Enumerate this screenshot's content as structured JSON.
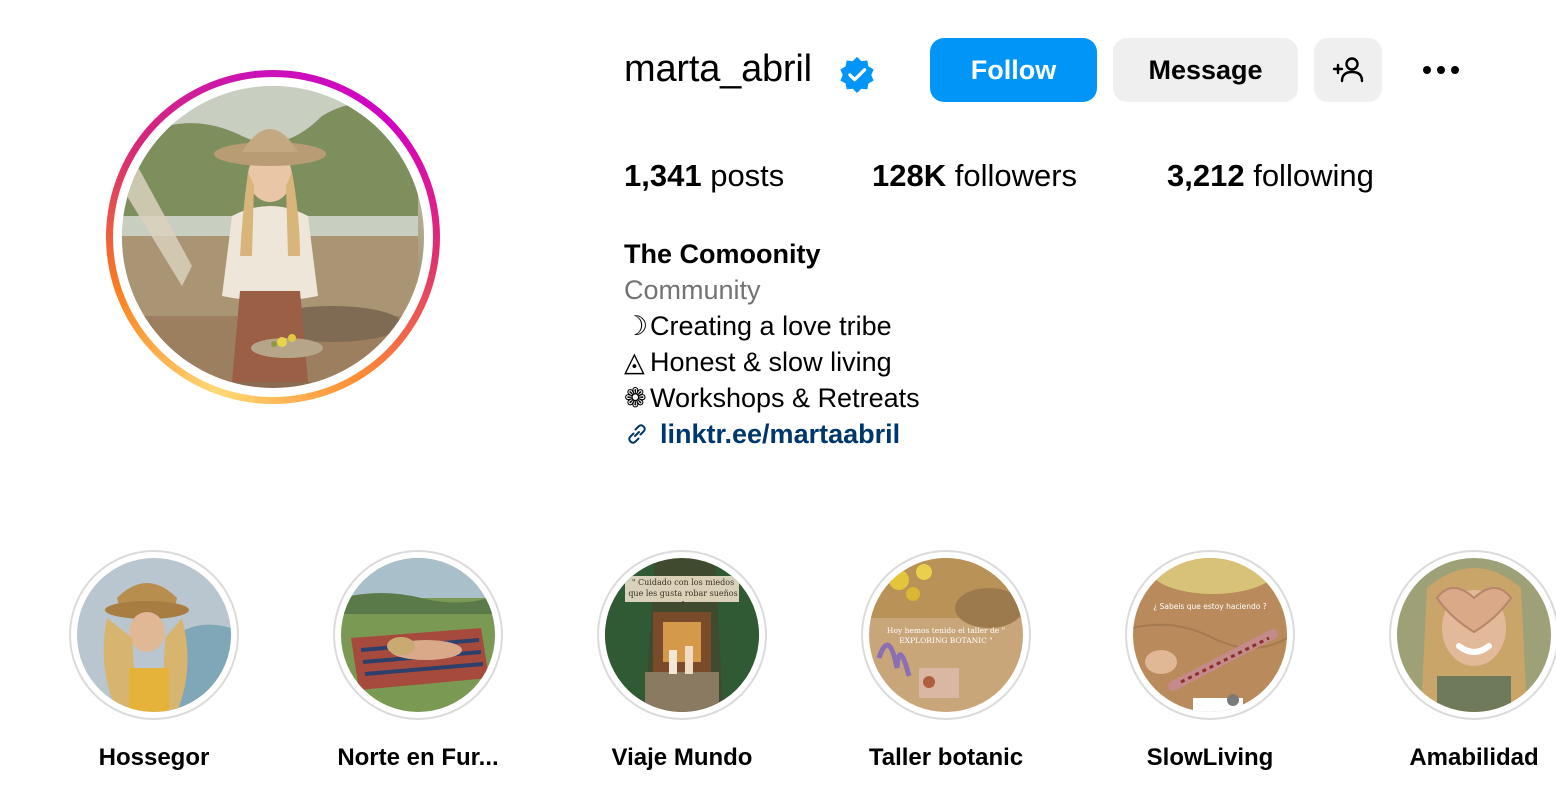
{
  "profile": {
    "username": "marta_abril",
    "verified": true,
    "verified_color": "#0095f6"
  },
  "actions": {
    "follow_label": "Follow",
    "message_label": "Message",
    "adduser_icon": "add-user-icon",
    "more_icon": "more-options-icon"
  },
  "stats": {
    "posts_count": "1,341",
    "posts_label": "posts",
    "followers_count": "128K",
    "followers_label": "followers",
    "following_count": "3,212",
    "following_label": "following"
  },
  "bio": {
    "name": "The Comoonity",
    "category": "Community",
    "lines": [
      {
        "symbol": "☽",
        "text": "Creating a love tribe"
      },
      {
        "symbol": "◬",
        "text": "Honest & slow living"
      },
      {
        "symbol": "❁",
        "text": "Workshops & Retreats"
      }
    ],
    "link_icon": "link-icon",
    "link": "linktr.ee/martaabril"
  },
  "highlights": [
    {
      "label": "Hossegor"
    },
    {
      "label": "Norte en Fur..."
    },
    {
      "label": "Viaje Mundo",
      "overlay_text": "\" Cuidado con los miedos que les gusta robar sueños \""
    },
    {
      "label": "Taller botanic",
      "overlay_text": "Hoy hemos tenido el taller de \" EXPLORING BOTANIC \""
    },
    {
      "label": "SlowLiving",
      "overlay_text": "¿ Sabeis que estoy haciendo ?"
    },
    {
      "label": "Amabilidad"
    }
  ],
  "colors": {
    "accent": "#0095f6",
    "link": "#00376b",
    "secondary_text": "#737373",
    "button_gray": "#efefef"
  }
}
